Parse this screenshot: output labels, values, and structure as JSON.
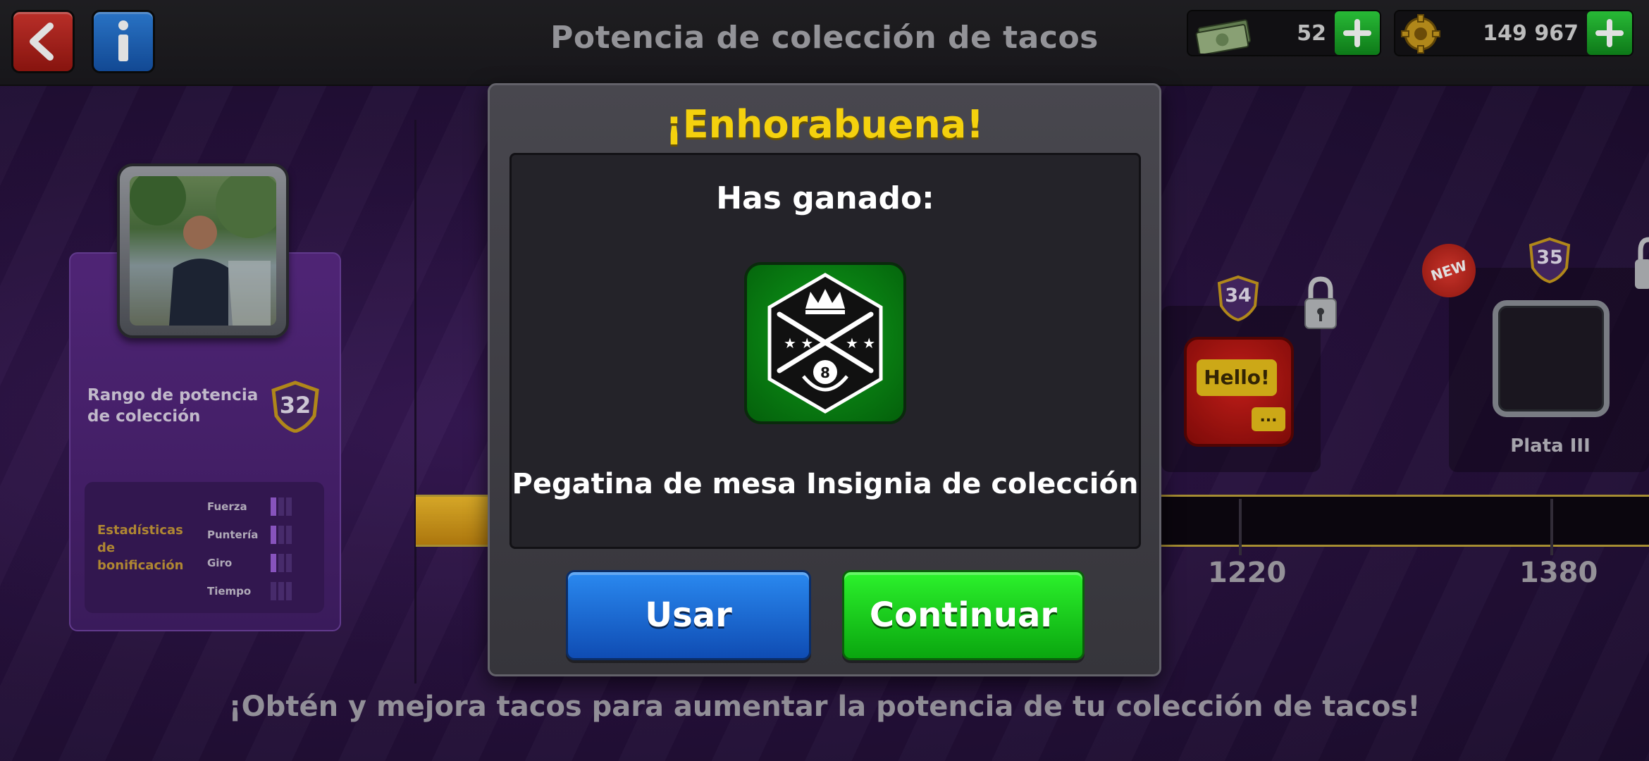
{
  "header": {
    "title": "Potencia de colección de tacos",
    "cash_value": "52",
    "coins_value": "149 967"
  },
  "profile": {
    "rank_label": "Rango de potencia de colección",
    "rank_value": "32"
  },
  "bonus_stats": {
    "title": "Estadísticas de bonificación",
    "items": [
      {
        "name": "Fuerza",
        "level": 1
      },
      {
        "name": "Puntería",
        "level": 1
      },
      {
        "name": "Giro",
        "level": 1
      },
      {
        "name": "Tiempo",
        "level": 0
      }
    ]
  },
  "track": {
    "milestones": [
      {
        "value": "1220",
        "badge": "34",
        "reward": "Hello!",
        "reward_extra": "..."
      },
      {
        "value": "1380",
        "badge": "35",
        "reward_label": "Plata III",
        "new_tag": "NEW"
      }
    ]
  },
  "footer": {
    "text": "¡Obtén y mejora tacos para aumentar la potencia de tu colección de tacos!"
  },
  "modal": {
    "title": "¡Enhorabuena!",
    "subtitle": "Has ganado:",
    "reward_name": "Pegatina de mesa Insignia de colección",
    "use_label": "Usar",
    "continue_label": "Continuar"
  },
  "colors": {
    "accent_yellow": "#f4d10e",
    "use_blue": "#1a6ad6",
    "continue_green": "#12c416"
  }
}
